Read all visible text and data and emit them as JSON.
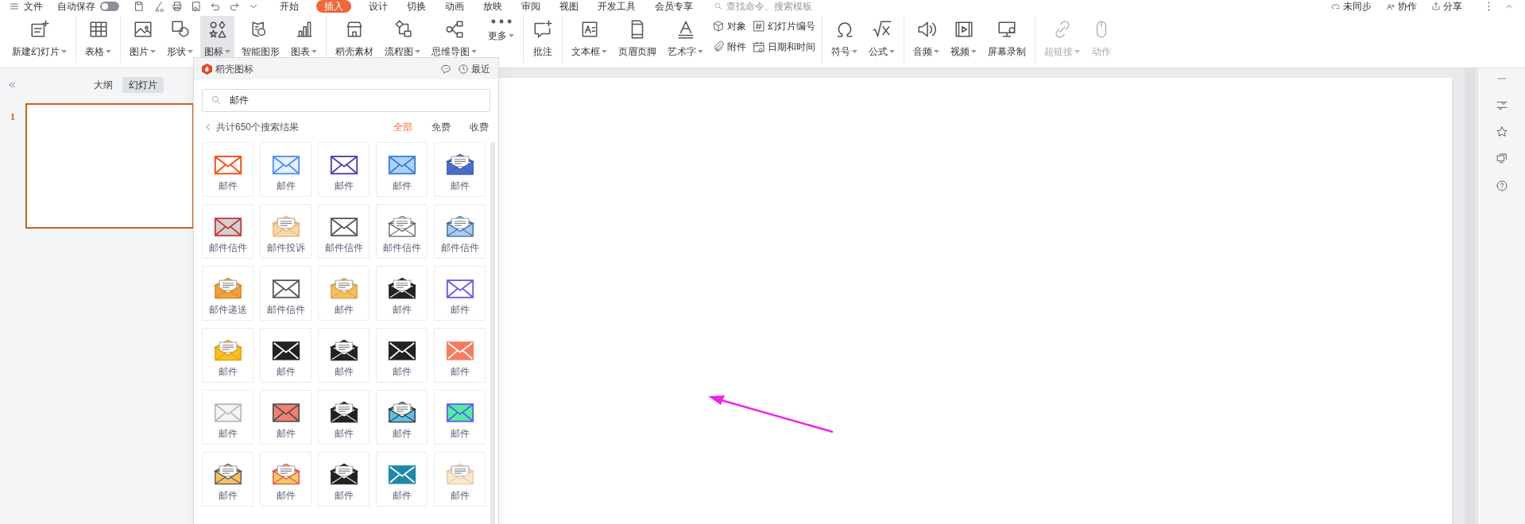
{
  "title_bar": {
    "file_menu": "文件",
    "autosave": {
      "label": "自动保存",
      "on": false
    },
    "tabs": [
      {
        "label": "开始",
        "selected": false
      },
      {
        "label": "插入",
        "selected": true
      },
      {
        "label": "设计",
        "selected": false
      },
      {
        "label": "切换",
        "selected": false
      },
      {
        "label": "动画",
        "selected": false
      },
      {
        "label": "放映",
        "selected": false
      },
      {
        "label": "审阅",
        "selected": false
      },
      {
        "label": "视图",
        "selected": false
      },
      {
        "label": "开发工具",
        "selected": false
      },
      {
        "label": "会员专享",
        "selected": false
      }
    ],
    "search": {
      "placeholder": "查找命令、搜索模板"
    },
    "actions": [
      "未同步",
      "协作",
      "分享"
    ]
  },
  "ribbon": {
    "groups": [
      [
        {
          "label": "新建幻灯片",
          "dropdown": true
        }
      ],
      [
        {
          "label": "表格",
          "dropdown": true
        }
      ],
      [
        {
          "label": "图片",
          "dropdown": true
        },
        {
          "label": "形状",
          "dropdown": true
        },
        {
          "label": "图标",
          "dropdown": true,
          "selected": true
        },
        {
          "label": "智能图形"
        },
        {
          "label": "图表",
          "dropdown": true
        }
      ],
      [
        {
          "label": "稻壳素材"
        },
        {
          "label": "流程图",
          "dropdown": true
        },
        {
          "label": "思维导图",
          "dropdown": true
        },
        {
          "label": "更多",
          "dropdown": true
        }
      ],
      [
        {
          "label": "批注"
        }
      ],
      [
        {
          "label": "文本框",
          "dropdown": true
        },
        {
          "label": "页眉页脚"
        },
        {
          "label": "艺术字",
          "dropdown": true
        },
        {
          "label": "对象",
          "kind": "small"
        },
        {
          "label": "附件",
          "kind": "small"
        },
        {
          "label": "幻灯片编号",
          "kind": "small"
        },
        {
          "label": "日期和时间",
          "kind": "small"
        }
      ],
      [
        {
          "label": "符号",
          "dropdown": true
        },
        {
          "label": "公式",
          "dropdown": true
        }
      ],
      [
        {
          "label": "音频",
          "dropdown": true
        },
        {
          "label": "视频",
          "dropdown": true
        },
        {
          "label": "屏幕录制"
        }
      ],
      [
        {
          "label": "超链接",
          "dropdown": true,
          "disabled": true
        },
        {
          "label": "动作",
          "disabled": true
        }
      ]
    ]
  },
  "slides_panel": {
    "tabs": [
      {
        "label": "大纲",
        "selected": false
      },
      {
        "label": "幻灯片",
        "selected": true
      }
    ],
    "slides": [
      {
        "number": "1",
        "selected": true
      }
    ]
  },
  "icon_panel": {
    "title": "稻壳图标",
    "recent": "最近",
    "search_value": "邮件",
    "result_count": "共计650个搜索结果",
    "filters": [
      {
        "label": "全部",
        "selected": true
      },
      {
        "label": "免费",
        "selected": false
      },
      {
        "label": "收费",
        "selected": false
      }
    ],
    "results": [
      {
        "label": "邮件"
      },
      {
        "label": "邮件"
      },
      {
        "label": "邮件"
      },
      {
        "label": "邮件"
      },
      {
        "label": "邮件"
      },
      {
        "label": "邮件信件"
      },
      {
        "label": "邮件投诉"
      },
      {
        "label": "邮件信件"
      },
      {
        "label": "邮件信件"
      },
      {
        "label": "邮件信件"
      },
      {
        "label": "邮件递送"
      },
      {
        "label": "邮件信件"
      },
      {
        "label": "邮件"
      },
      {
        "label": "邮件"
      },
      {
        "label": "邮件"
      },
      {
        "label": "邮件"
      },
      {
        "label": "邮件"
      },
      {
        "label": "邮件"
      },
      {
        "label": "邮件"
      },
      {
        "label": "邮件"
      },
      {
        "label": "邮件"
      },
      {
        "label": "邮件"
      },
      {
        "label": "邮件"
      },
      {
        "label": "邮件"
      },
      {
        "label": "邮件"
      },
      {
        "label": "邮件"
      },
      {
        "label": "邮件"
      },
      {
        "label": "邮件"
      },
      {
        "label": "邮件"
      },
      {
        "label": "邮件"
      }
    ]
  }
}
